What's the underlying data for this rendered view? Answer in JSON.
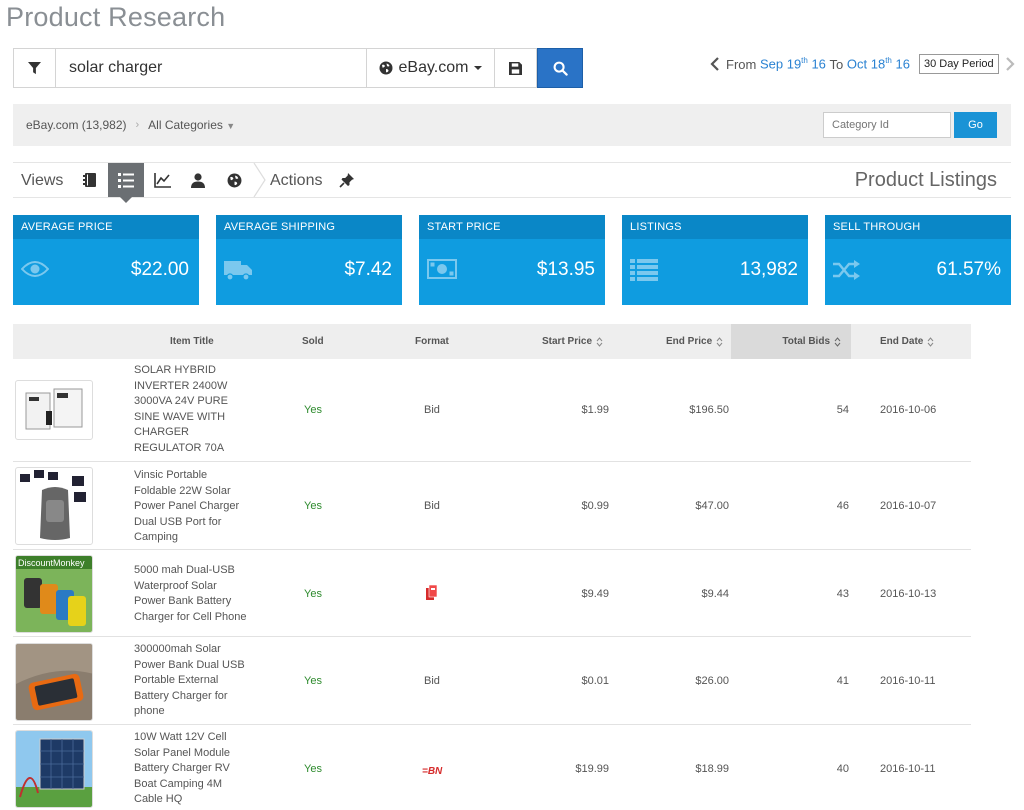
{
  "page_title": "Product Research",
  "search": {
    "query": "solar charger",
    "site": "eBay.com"
  },
  "date_range": {
    "from_label": "From",
    "from_date": "Sep 19",
    "from_sup": "th",
    "from_year": " 16",
    "to_label": "To",
    "to_date": "Oct 18",
    "to_sup": "th",
    "to_year": " 16",
    "period": "30 Day Period"
  },
  "category_bar": {
    "site_count": "eBay.com (13,982)",
    "category": "All Categories",
    "category_placeholder": "Category Id",
    "go_label": "Go"
  },
  "views_bar": {
    "views_label": "Views",
    "actions_label": "Actions",
    "section_title": "Product Listings"
  },
  "stats": [
    {
      "label": "AVERAGE PRICE",
      "value": "$22.00",
      "icon": "eye-icon"
    },
    {
      "label": "AVERAGE SHIPPING",
      "value": "$7.42",
      "icon": "truck-icon"
    },
    {
      "label": "START PRICE",
      "value": "$13.95",
      "icon": "money-icon"
    },
    {
      "label": "LISTINGS",
      "value": "13,982",
      "icon": "list-icon"
    },
    {
      "label": "SELL THROUGH",
      "value": "61.57%",
      "icon": "shuffle-icon"
    }
  ],
  "table": {
    "columns": [
      "Item Title",
      "Sold",
      "Format",
      "Start Price",
      "End Price",
      "Total Bids",
      "End Date"
    ],
    "rows": [
      {
        "title": [
          "SOLAR HYBRID",
          "INVERTER 2400W",
          "3000VA 24V PURE",
          "SINE WAVE WITH",
          "CHARGER",
          "REGULATOR 70A"
        ],
        "sold": "Yes",
        "format": "Bid",
        "start": "$1.99",
        "end": "$196.50",
        "bids": "54",
        "date": "2016-10-06"
      },
      {
        "title": [
          "Vinsic Portable",
          "Foldable 22W Solar",
          "Power Panel Charger",
          "Dual USB Port for",
          "Camping"
        ],
        "sold": "Yes",
        "format": "Bid",
        "start": "$0.99",
        "end": "$47.00",
        "bids": "46",
        "date": "2016-10-07"
      },
      {
        "title": [
          "5000 mah Dual-USB",
          "Waterproof Solar",
          "Power Bank Battery",
          "Charger for Cell Phone"
        ],
        "sold": "Yes",
        "format": "",
        "start": "$9.49",
        "end": "$9.44",
        "bids": "43",
        "date": "2016-10-13"
      },
      {
        "title": [
          "300000mah Solar",
          "Power Bank Dual USB",
          "Portable External",
          "Battery Charger for",
          "phone"
        ],
        "sold": "Yes",
        "format": "Bid",
        "start": "$0.01",
        "end": "$26.00",
        "bids": "41",
        "date": "2016-10-11"
      },
      {
        "title": [
          "10W Watt 12V Cell",
          "Solar Panel Module",
          "Battery Charger RV",
          "Boat Camping 4M",
          "Cable HQ"
        ],
        "sold": "Yes",
        "format": "",
        "start": "$19.99",
        "end": "$18.99",
        "bids": "40",
        "date": "2016-10-11"
      }
    ],
    "thumb3_banner": "DiscountMonkey"
  },
  "format_badges": {
    "buy_now": "=BN"
  },
  "colors": {
    "accent": "#0f9ce0",
    "search_button": "#2a73c6",
    "sold_green": "#2e8b2e",
    "date_blue": "#2a82d2"
  }
}
